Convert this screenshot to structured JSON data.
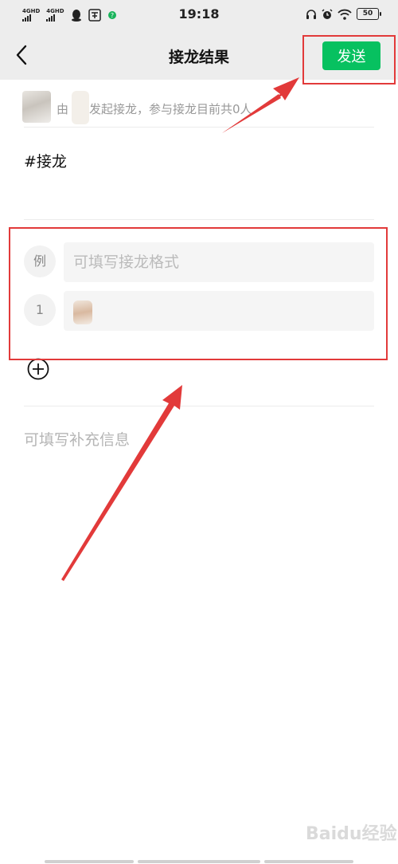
{
  "status_bar": {
    "signal_1": "4GHD",
    "signal_2": "4GHD",
    "time": "19:18",
    "battery": "50"
  },
  "header": {
    "title": "接龙结果",
    "send_label": "发送"
  },
  "info": {
    "prefix": "由",
    "text": "发起接龙，参与接龙目前共0人"
  },
  "topic": "#接龙",
  "entries": [
    {
      "number": "例",
      "placeholder": "可填写接龙格式"
    },
    {
      "number": "1"
    }
  ],
  "supplement_placeholder": "可填写补充信息",
  "watermark": "Baidu经验",
  "annotation_color": "#e23a3a",
  "accent_color": "#07c160"
}
